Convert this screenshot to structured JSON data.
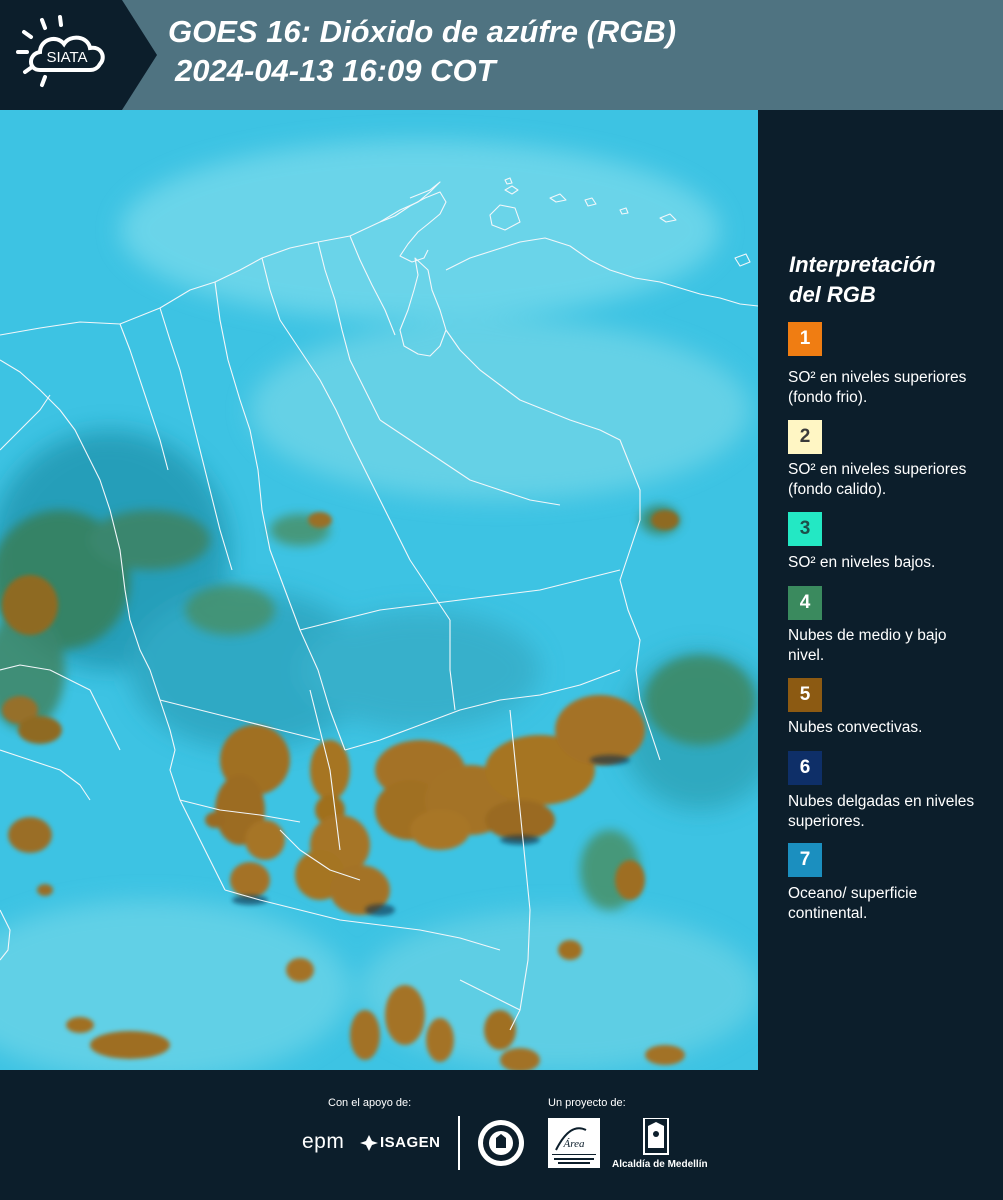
{
  "header": {
    "logo_text": "SIATA",
    "title_line1": "GOES 16: Dióxido de azúfre (RGB)",
    "title_line2": "2024-04-13 16:09 COT"
  },
  "legend": {
    "title_line1": "Interpretación",
    "title_line2": "del RGB",
    "items": [
      {
        "number": "1",
        "color": "#f07d12",
        "text": "SO² en niveles superiores (fondo frio)."
      },
      {
        "number": "2",
        "color": "#fff6c4",
        "text": "SO² en niveles superiores (fondo calido)."
      },
      {
        "number": "3",
        "color": "#23e8c4",
        "text": "SO² en niveles bajos."
      },
      {
        "number": "4",
        "color": "#3a8a5e",
        "text": "Nubes de medio y bajo nivel."
      },
      {
        "number": "5",
        "color": "#8c5a12",
        "text": "Nubes convectivas."
      },
      {
        "number": "6",
        "color": "#0e2f68",
        "text": "Nubes delgadas en niveles superiores."
      },
      {
        "number": "7",
        "color": "#1b8fbf",
        "text": "Oceano/ superficie continental."
      }
    ]
  },
  "footer": {
    "support_label": "Con el apoyo de:",
    "project_label": "Un proyecto de:",
    "sponsors": [
      "epm",
      "ISAGEN"
    ],
    "project_partners": [
      "Área Metropolitana Valle de Aburrá",
      "Alcaldía de Medellín"
    ],
    "alcaldia_text": "Alcaldía de Medellín"
  },
  "colors": {
    "header_bg": "#4f7381",
    "page_bg": "#0c1e2b",
    "map_background": "#37bfe0",
    "convective_cloud": "#9a6a1c"
  }
}
